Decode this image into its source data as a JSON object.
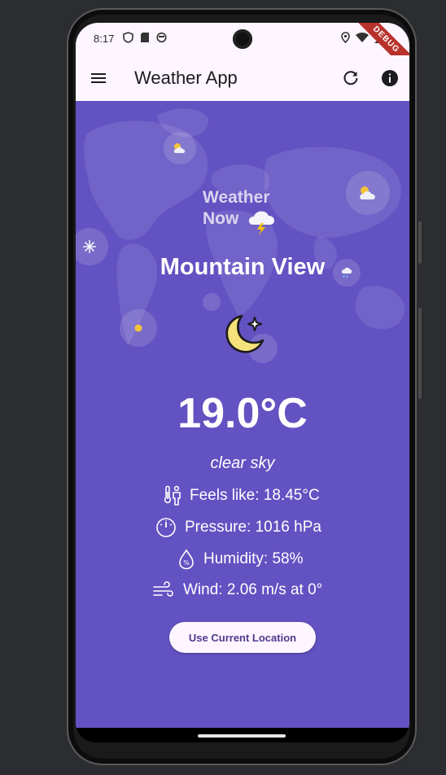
{
  "status_bar": {
    "time": "8:17"
  },
  "debug_banner": "DEBUG",
  "app_bar": {
    "title": "Weather App",
    "menu_icon": "menu-icon",
    "refresh_icon": "refresh-icon",
    "info_icon": "info-icon"
  },
  "logo": {
    "line1": "Weather",
    "line2": "Now"
  },
  "weather": {
    "city": "Mountain View",
    "temperature": "19.0°C",
    "description": "clear sky",
    "condition_icon": "moon-star-icon",
    "details": {
      "feels_like": "Feels like: 18.45°C",
      "pressure": "Pressure: 1016 hPa",
      "humidity": "Humidity: 58%",
      "wind": "Wind: 2.06 m/s at 0°"
    }
  },
  "actions": {
    "use_location_label": "Use Current Location"
  },
  "colors": {
    "background": "#6352c2",
    "app_bar": "#fdf5ff",
    "button_text": "#4e3a8d",
    "moon": "#f5e27a"
  }
}
